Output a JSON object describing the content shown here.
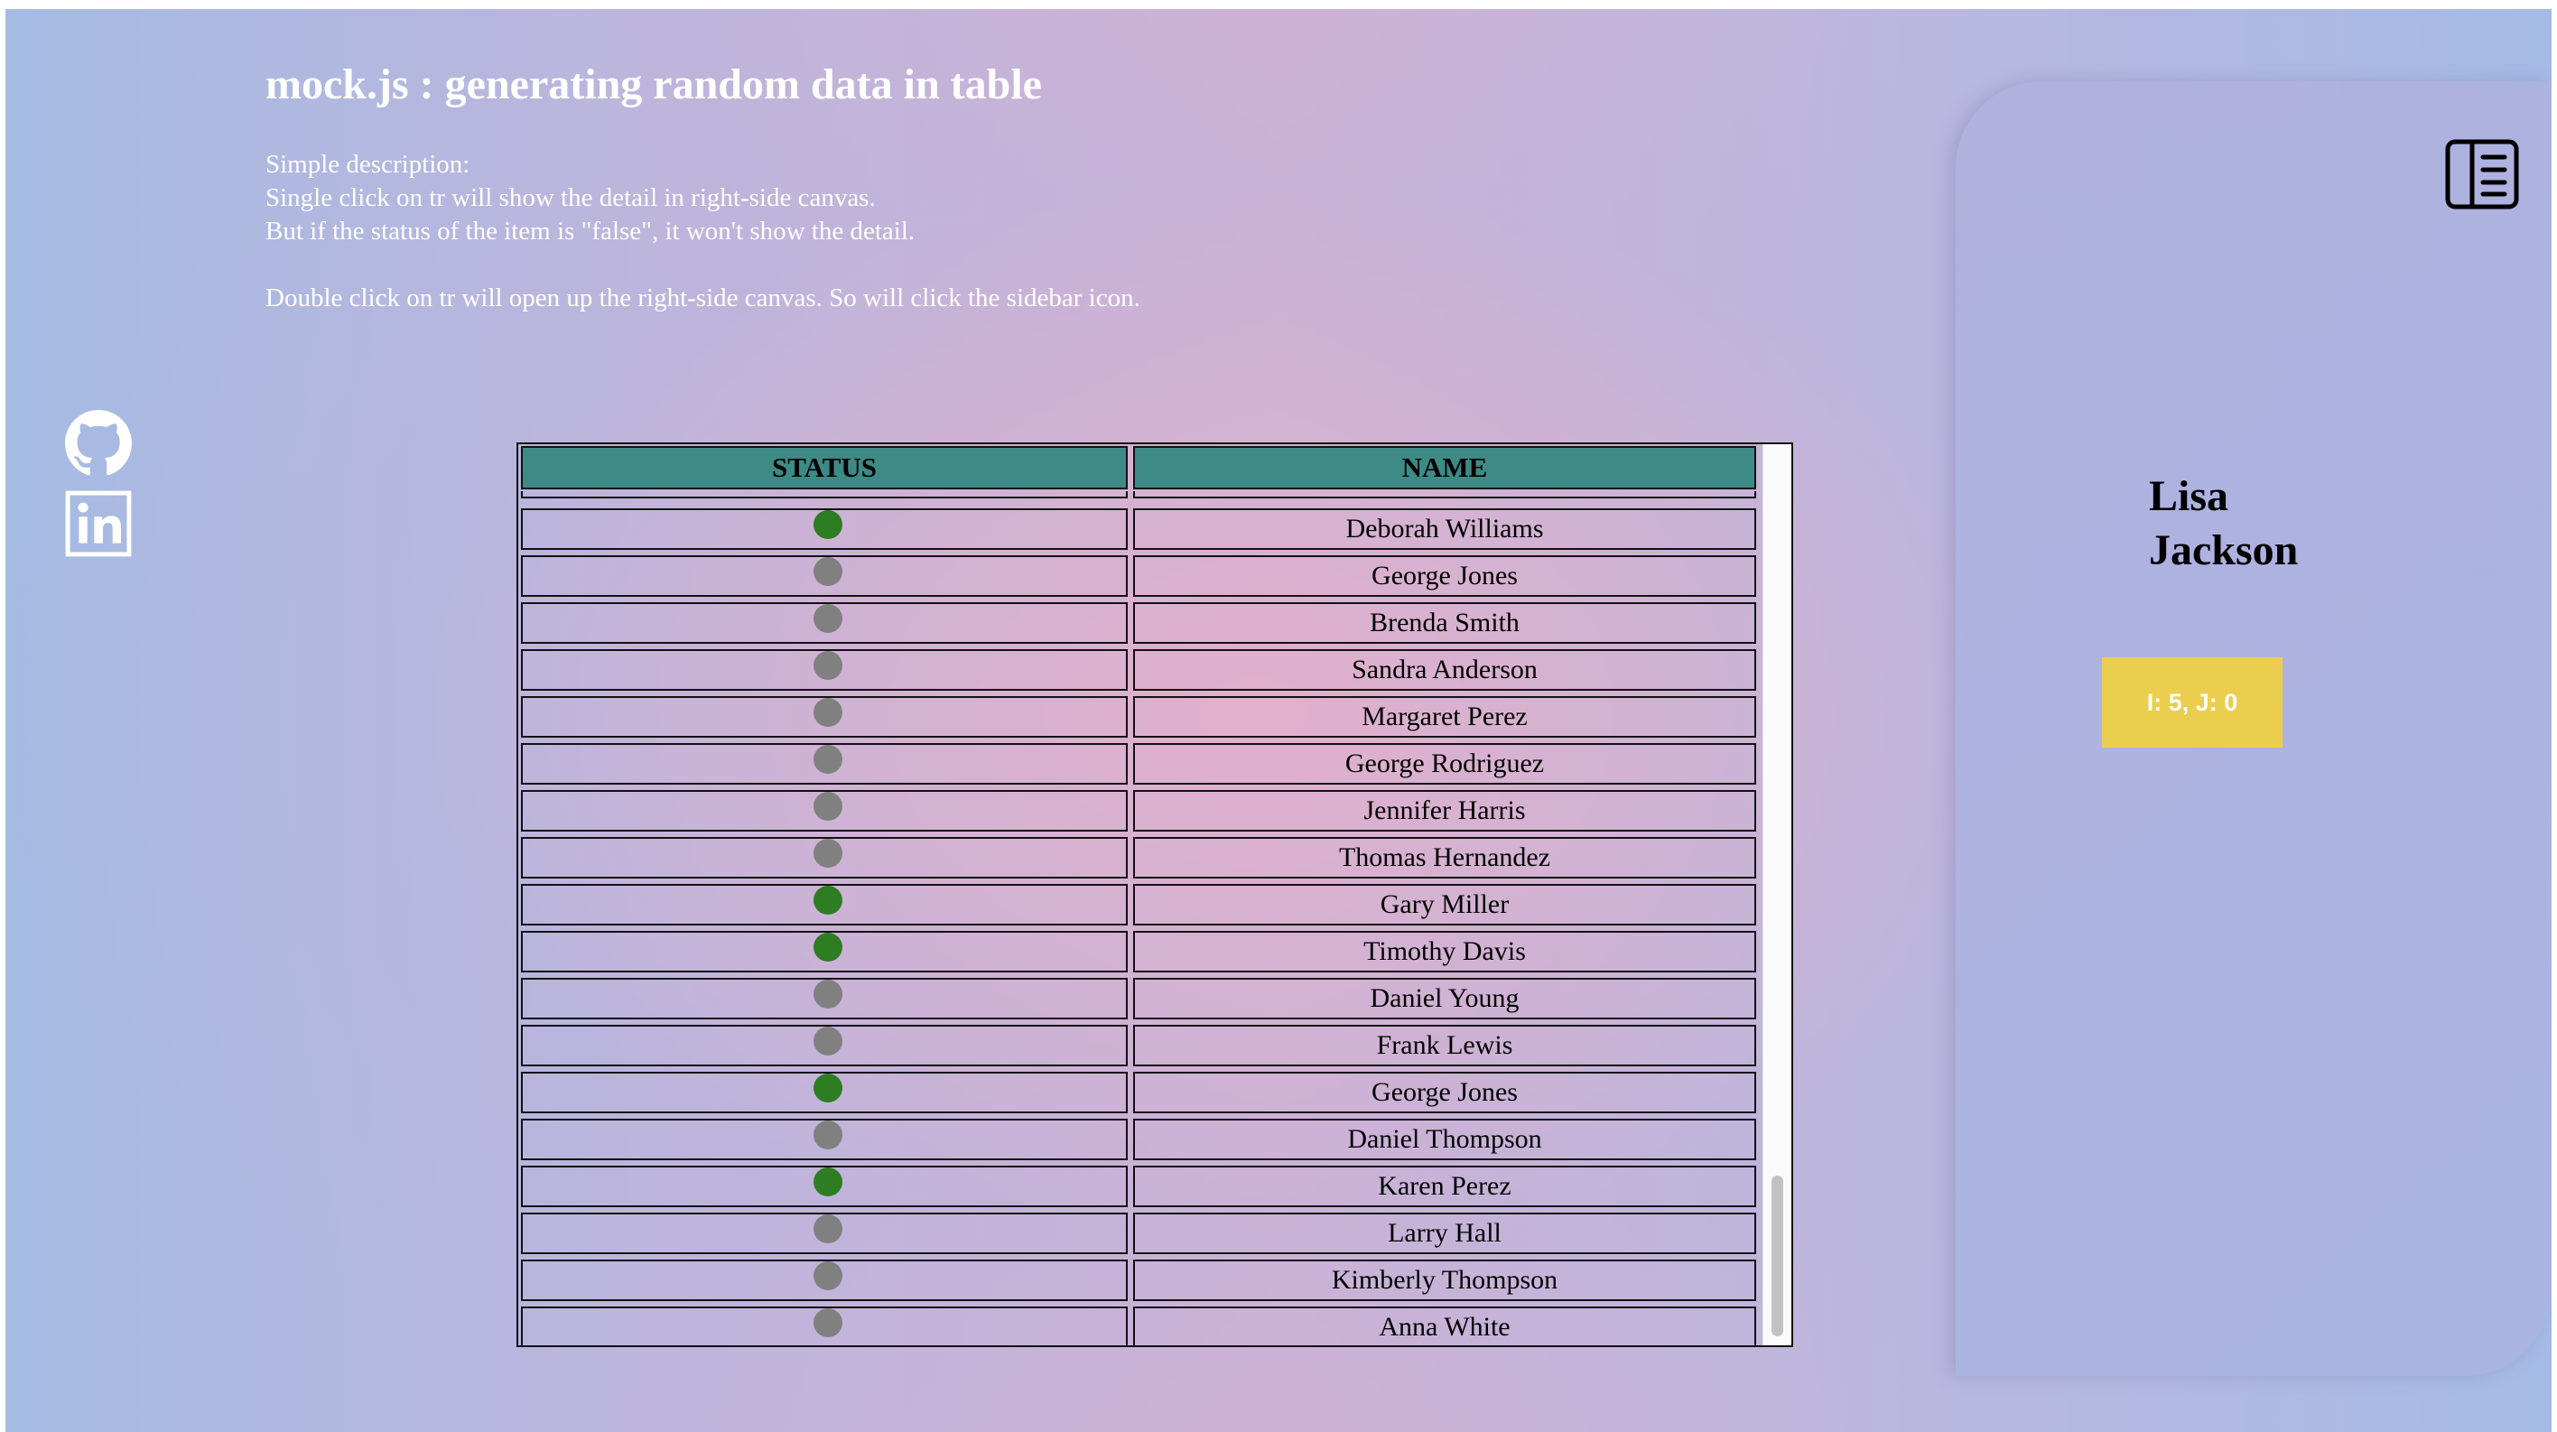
{
  "header": {
    "title": "mock.js : generating random data in table",
    "description_lines": [
      "Simple description:",
      "Single click on tr will show the detail in right-side canvas.",
      "But if the status of the item is \"false\", it won't show the detail.",
      "Double click on tr will open up the right-side canvas. So will click the sidebar icon."
    ]
  },
  "social": {
    "github_icon": "github-icon",
    "linkedin_icon": "linkedin-icon"
  },
  "table": {
    "columns": [
      "STATUS",
      "NAME"
    ],
    "status_colors": {
      "true": "#2e7d22",
      "false": "#808080"
    },
    "header_color": "#3d8a87",
    "rows": [
      {
        "status": true,
        "name": "Deborah Williams"
      },
      {
        "status": false,
        "name": "George Jones"
      },
      {
        "status": false,
        "name": "Brenda Smith"
      },
      {
        "status": false,
        "name": "Sandra Anderson"
      },
      {
        "status": false,
        "name": "Margaret Perez"
      },
      {
        "status": false,
        "name": "George Rodriguez"
      },
      {
        "status": false,
        "name": "Jennifer Harris"
      },
      {
        "status": false,
        "name": "Thomas Hernandez"
      },
      {
        "status": true,
        "name": "Gary Miller"
      },
      {
        "status": true,
        "name": "Timothy Davis"
      },
      {
        "status": false,
        "name": "Daniel Young"
      },
      {
        "status": false,
        "name": "Frank Lewis"
      },
      {
        "status": true,
        "name": "George Jones"
      },
      {
        "status": false,
        "name": "Daniel Thompson"
      },
      {
        "status": true,
        "name": "Karen Perez"
      },
      {
        "status": false,
        "name": "Larry Hall"
      },
      {
        "status": false,
        "name": "Kimberly Thompson"
      },
      {
        "status": false,
        "name": "Anna White"
      }
    ]
  },
  "canvas": {
    "sidebar_icon": "sidebar-icon",
    "detail_first_name": "Lisa",
    "detail_last_name": "Jackson",
    "detail_badge": "I: 5, J: 0",
    "badge_color": "#ecce4f"
  }
}
